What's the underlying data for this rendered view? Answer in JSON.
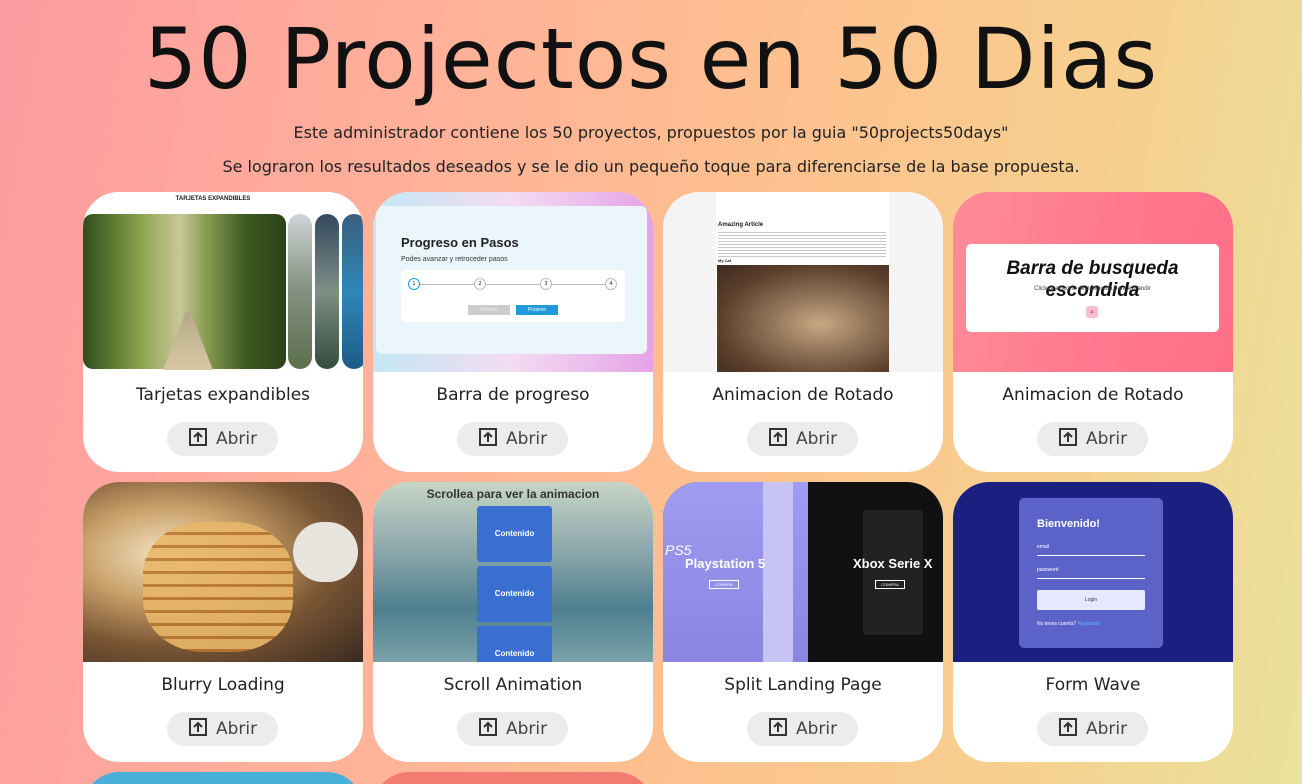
{
  "header": {
    "title": "50 Projectos en 50 Dias",
    "subtitle1": "Este administrador contiene los 50 proyectos, propuestos por la guia \"50projects50days\"",
    "subtitle2": "Se lograron los resultados deseados y se le dio un pequeño toque para diferenciarse de la base propuesta."
  },
  "button_label": "Abrir",
  "cards": [
    {
      "title": "Tarjetas expandibles",
      "thumb_text": "TARJETAS EXPANDIBLES"
    },
    {
      "title": "Barra de progreso",
      "thumb_title": "Progreso en Pasos",
      "thumb_sub": "Podes avanzar y retroceder pasos",
      "steps": [
        "1",
        "2",
        "3",
        "4"
      ],
      "prev": "Anterior",
      "next": "Proximo"
    },
    {
      "title": "Animacion de Rotado",
      "thumb_title": "Amazing Article",
      "thumb_sub": "My Cat"
    },
    {
      "title": "Animacion de Rotado",
      "thumb_title": "Barra de busqueda escondida",
      "thumb_sub": "Clickea el icono de busqueda para expandir"
    },
    {
      "title": "Blurry Loading"
    },
    {
      "title": "Scroll Animation",
      "thumb_title": "Scrollea para ver la animacion",
      "box": "Contenido"
    },
    {
      "title": "Split Landing Page",
      "left": "Playstation 5",
      "left_logo": "PS5",
      "right": "Xbox Serie X",
      "cta": "COMPRA"
    },
    {
      "title": "Form Wave",
      "thumb_title": "Bienvenido!",
      "email": "email",
      "password": "password",
      "login": "Login",
      "register_q": "No tenes cuenta?",
      "register": "Registrate"
    }
  ],
  "colors": {
    "accent": "#1e9bd8",
    "wave_bg": "#1b2080",
    "wave_panel": "#5b63c9"
  }
}
